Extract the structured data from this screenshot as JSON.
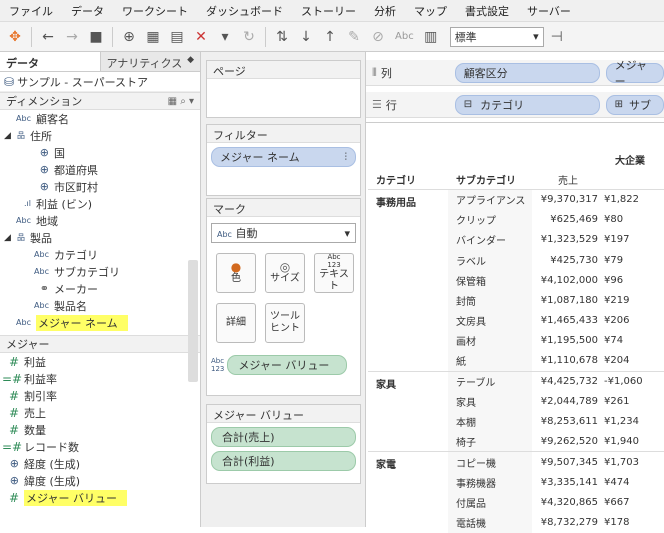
{
  "menu": [
    "ファイル",
    "データ",
    "ワークシート",
    "ダッシュボード",
    "ストーリー",
    "分析",
    "マップ",
    "書式設定",
    "サーバー"
  ],
  "toolbar": {
    "abc_label": "Abc",
    "format_value": "標準"
  },
  "left_pane": {
    "tabs": {
      "data": "データ",
      "analytics": "アナリティクス"
    },
    "datasource": "サンプル - スーパーストア",
    "dimensions_header": "ディメンション",
    "dimensions": [
      {
        "type": "abc",
        "label": "顧客名",
        "indent": 1
      },
      {
        "type": "hier",
        "label": "住所",
        "indent": 0
      },
      {
        "type": "glob",
        "label": "国",
        "indent": 2
      },
      {
        "type": "glob",
        "label": "都道府県",
        "indent": 2
      },
      {
        "type": "glob",
        "label": "市区町村",
        "indent": 2
      },
      {
        "type": "bin",
        "label": "利益 (ビン)",
        "indent": 1
      },
      {
        "type": "abc",
        "label": "地域",
        "indent": 1
      },
      {
        "type": "hier",
        "label": "製品",
        "indent": 0
      },
      {
        "type": "abc",
        "label": "カテゴリ",
        "indent": 2
      },
      {
        "type": "abc",
        "label": "サブカテゴリ",
        "indent": 2
      },
      {
        "type": "clip",
        "label": "メーカー",
        "indent": 2
      },
      {
        "type": "abc",
        "label": "製品名",
        "indent": 2
      },
      {
        "type": "abc",
        "label": "メジャー ネーム",
        "indent": 1,
        "highlight": true
      }
    ],
    "measures_header": "メジャー",
    "measures": [
      {
        "type": "hash",
        "label": "利益"
      },
      {
        "type": "hashc",
        "label": "利益率"
      },
      {
        "type": "hash",
        "label": "割引率"
      },
      {
        "type": "hash",
        "label": "売上"
      },
      {
        "type": "hash",
        "label": "数量"
      },
      {
        "type": "hashc",
        "label": "レコード数"
      },
      {
        "type": "glob",
        "label": "経度 (生成)"
      },
      {
        "type": "glob",
        "label": "緯度 (生成)"
      },
      {
        "type": "hash",
        "label": "メジャー バリュー",
        "highlight": true
      }
    ]
  },
  "shelves": {
    "pages": "ページ",
    "filters": "フィルター",
    "filter_pill": "メジャー ネーム",
    "marks": "マーク",
    "mark_type": "自動",
    "mark_type_prefix": "Abc",
    "mark_buttons": {
      "color": "色",
      "size": "サイズ",
      "text": "テキスト",
      "text_icon": "Abc\n123",
      "detail": "詳細",
      "tooltip": "ツール\nヒント"
    },
    "mark_pill": "メジャー バリュー",
    "mark_pill_icon": "Abc\n123",
    "measure_values": "メジャー バリュー",
    "measure_pills": [
      "合計(売上)",
      "合計(利益)"
    ]
  },
  "main": {
    "columns_label": "列",
    "rows_label": "行",
    "column_pills": [
      "顧客区分",
      "メジャー"
    ],
    "row_pills": [
      "カテゴリ",
      "サブ"
    ],
    "view": {
      "header_group": "大企業",
      "col_cat": "カテゴリ",
      "col_sub": "サブカテゴリ",
      "col_sales": "売上",
      "groups": [
        {
          "cat": "事務用品",
          "rows": [
            [
              "アプライアンス",
              "¥9,370,317",
              "¥1,822"
            ],
            [
              "クリップ",
              "¥625,469",
              "¥80"
            ],
            [
              "バインダー",
              "¥1,323,529",
              "¥197"
            ],
            [
              "ラベル",
              "¥425,730",
              "¥79"
            ],
            [
              "保管箱",
              "¥4,102,000",
              "¥96"
            ],
            [
              "封筒",
              "¥1,087,180",
              "¥219"
            ],
            [
              "文房具",
              "¥1,465,433",
              "¥206"
            ],
            [
              "画材",
              "¥1,195,500",
              "¥74"
            ],
            [
              "紙",
              "¥1,110,678",
              "¥204"
            ]
          ]
        },
        {
          "cat": "家具",
          "rows": [
            [
              "テーブル",
              "¥4,425,732",
              "-¥1,060"
            ],
            [
              "家具",
              "¥2,044,789",
              "¥261"
            ],
            [
              "本棚",
              "¥8,253,611",
              "¥1,234"
            ],
            [
              "椅子",
              "¥9,262,520",
              "¥1,940"
            ]
          ]
        },
        {
          "cat": "家電",
          "rows": [
            [
              "コピー機",
              "¥9,507,345",
              "¥1,703"
            ],
            [
              "事務機器",
              "¥3,335,141",
              "¥474"
            ],
            [
              "付属品",
              "¥4,320,865",
              "¥667"
            ],
            [
              "電話機",
              "¥8,732,279",
              "¥178"
            ]
          ]
        }
      ]
    }
  }
}
